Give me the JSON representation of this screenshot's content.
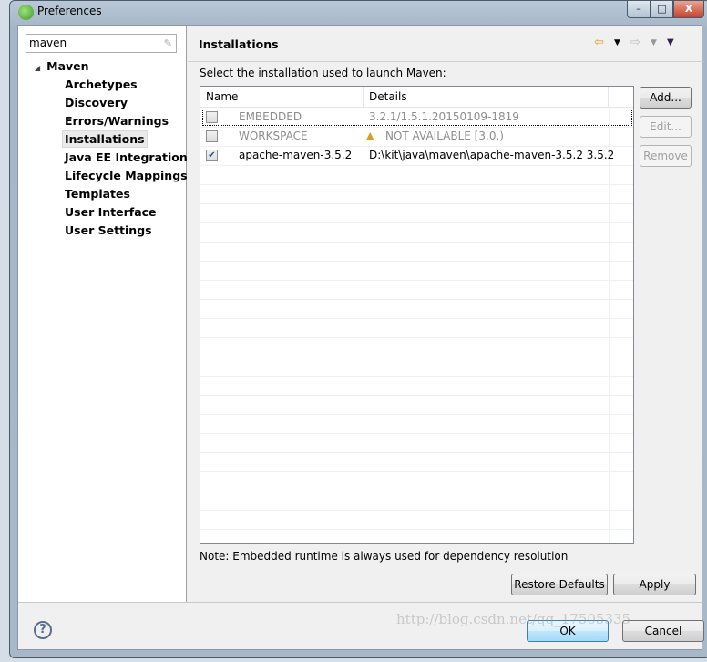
{
  "window": {
    "title": "Preferences",
    "minimize": "–",
    "maximize": "□",
    "close": "X"
  },
  "sidebar": {
    "search_value": "maven",
    "tree_root": "Maven",
    "items": [
      {
        "label": "Archetypes"
      },
      {
        "label": "Discovery"
      },
      {
        "label": "Errors/Warnings"
      },
      {
        "label": "Installations",
        "selected": true
      },
      {
        "label": "Java EE Integration"
      },
      {
        "label": "Lifecycle Mappings"
      },
      {
        "label": "Templates"
      },
      {
        "label": "User Interface"
      },
      {
        "label": "User Settings"
      }
    ]
  },
  "page": {
    "title": "Installations",
    "description": "Select the installation used to launch Maven:",
    "columns": [
      "Name",
      "Details"
    ],
    "rows": [
      {
        "checked": false,
        "name": "EMBEDDED",
        "details": "3.2.1/1.5.1.20150109-1819",
        "enabled": false
      },
      {
        "checked": false,
        "name": "WORKSPACE",
        "details": "NOT AVAILABLE [3.0,)",
        "warning": true,
        "enabled": false
      },
      {
        "checked": true,
        "name": "apache-maven-3.5.2",
        "details": "D:\\kit\\java\\maven\\apache-maven-3.5.2 3.5.2",
        "enabled": true
      }
    ],
    "buttons": {
      "add": "Add...",
      "edit": "Edit...",
      "remove": "Remove"
    },
    "note": "Note: Embedded runtime is always used for dependency resolution",
    "restore_defaults": "Restore Defaults",
    "apply": "Apply"
  },
  "footer": {
    "ok": "OK",
    "cancel": "Cancel",
    "help": "?"
  },
  "watermark": "http://blog.csdn.net/qq_17505335",
  "colors": {
    "selection": "#eaeaea",
    "default_button": "#3c7fb1",
    "disabled_text": "#8d8d8d"
  }
}
